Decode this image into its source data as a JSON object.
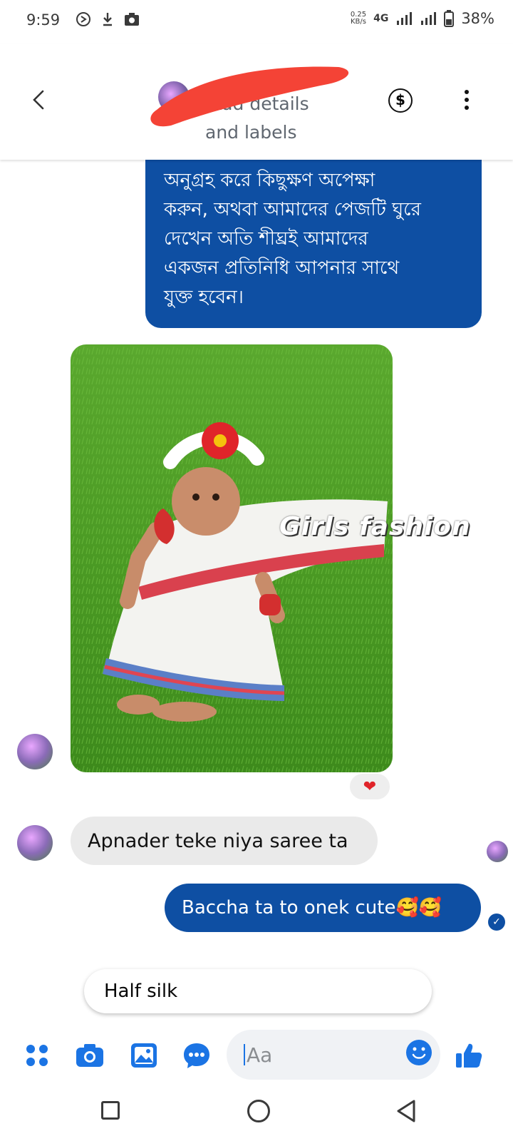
{
  "status_bar": {
    "time": "9:59",
    "speed_value": "0.25",
    "speed_unit": "KB/s",
    "network": "4G",
    "battery": "38%"
  },
  "header": {
    "subtitle_line1": "Add details",
    "subtitle_line2": "and labels",
    "dollar_symbol": "$"
  },
  "messages": {
    "page_reply_lines": [
      "অনুগ্রহ করে কিছুক্ষণ অপেক্ষা",
      "করুন, অথবা আমাদের পেজটি ঘুরে",
      "দেখেন  অতি শীঘ্রই  আমাদের",
      "একজন প্রতিনিধি আপনার সাথে",
      "যুক্ত হবেন।"
    ],
    "photo_watermark": "Girls fashion",
    "photo_reaction": "❤",
    "incoming_text": "Apnader teke niya saree ta",
    "outgoing_text": "Baccha ta to onek cute🥰🥰",
    "sent_check": "✓",
    "quick_reply_text": "Half silk"
  },
  "composer": {
    "placeholder": "Aa"
  },
  "colors": {
    "accent": "#1b74e4",
    "bubble_blue": "#0e4fa3",
    "bubble_grey": "#eaeaea",
    "redaction": "#f44336"
  }
}
